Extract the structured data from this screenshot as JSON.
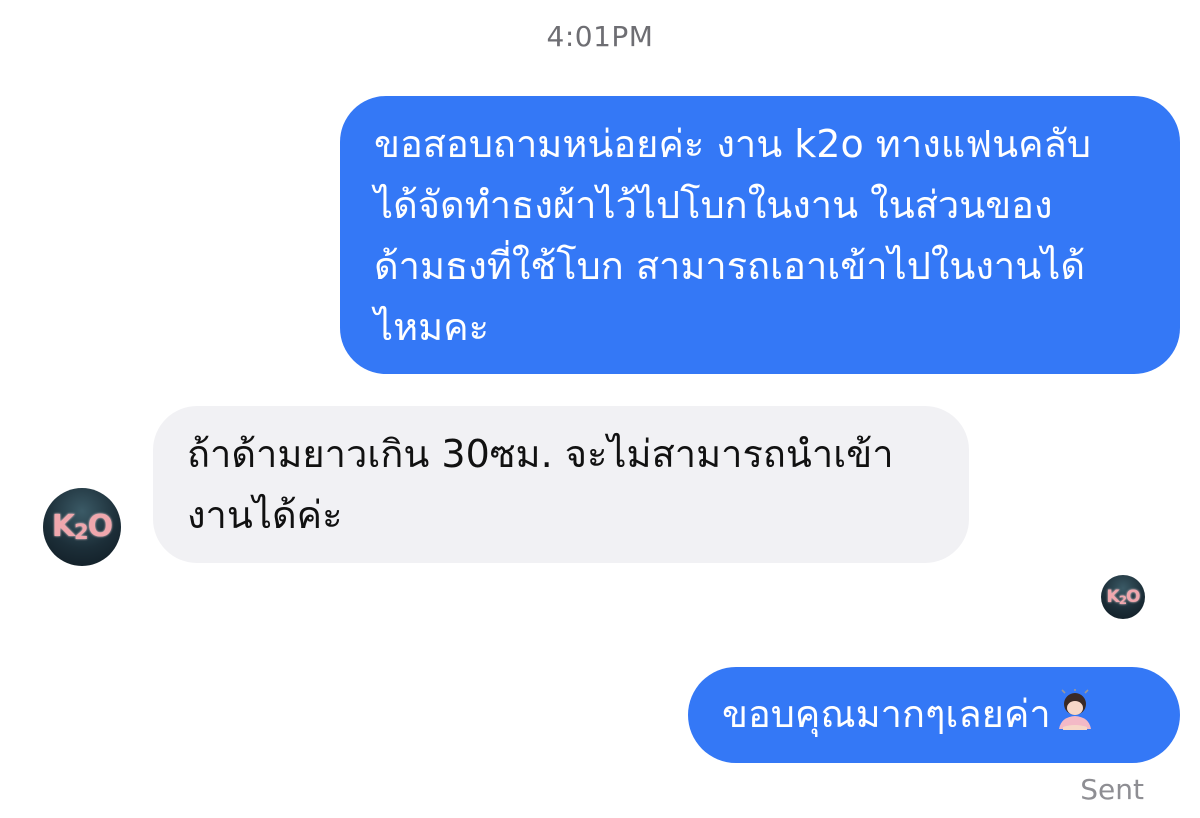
{
  "conversation": {
    "timestamp": "4:01PM",
    "messages": [
      {
        "direction": "sent",
        "lines": [
          "ขอสอบถามหน่อยค่ะ งาน k2o ทางแฟนคลับ",
          "ได้จัดทำธงผ้าไว้ไปโบกในงาน ในส่วนของ",
          "ด้ามธงที่ใช้โบก สามารถเอาเข้าไปในงานได้",
          "ไหมคะ"
        ]
      },
      {
        "direction": "received",
        "lines": [
          "ถ้าด้ามยาวเกิน 30ซม. จะไม่สามารถนำเข้า",
          "งานได้ค่ะ"
        ]
      },
      {
        "direction": "sent",
        "lines": [
          "ขอบคุณมากๆเลยค่า"
        ],
        "emoji": "person-bowing-emoji"
      }
    ],
    "status": "Sent"
  },
  "avatar": {
    "text": "K2O",
    "icon": "k2o-logo-avatar"
  },
  "colors": {
    "sent_bubble": "#3478f6",
    "received_bubble": "#f1f1f4",
    "timestamp_text": "#6e6e73",
    "status_text": "#8e8e93"
  }
}
